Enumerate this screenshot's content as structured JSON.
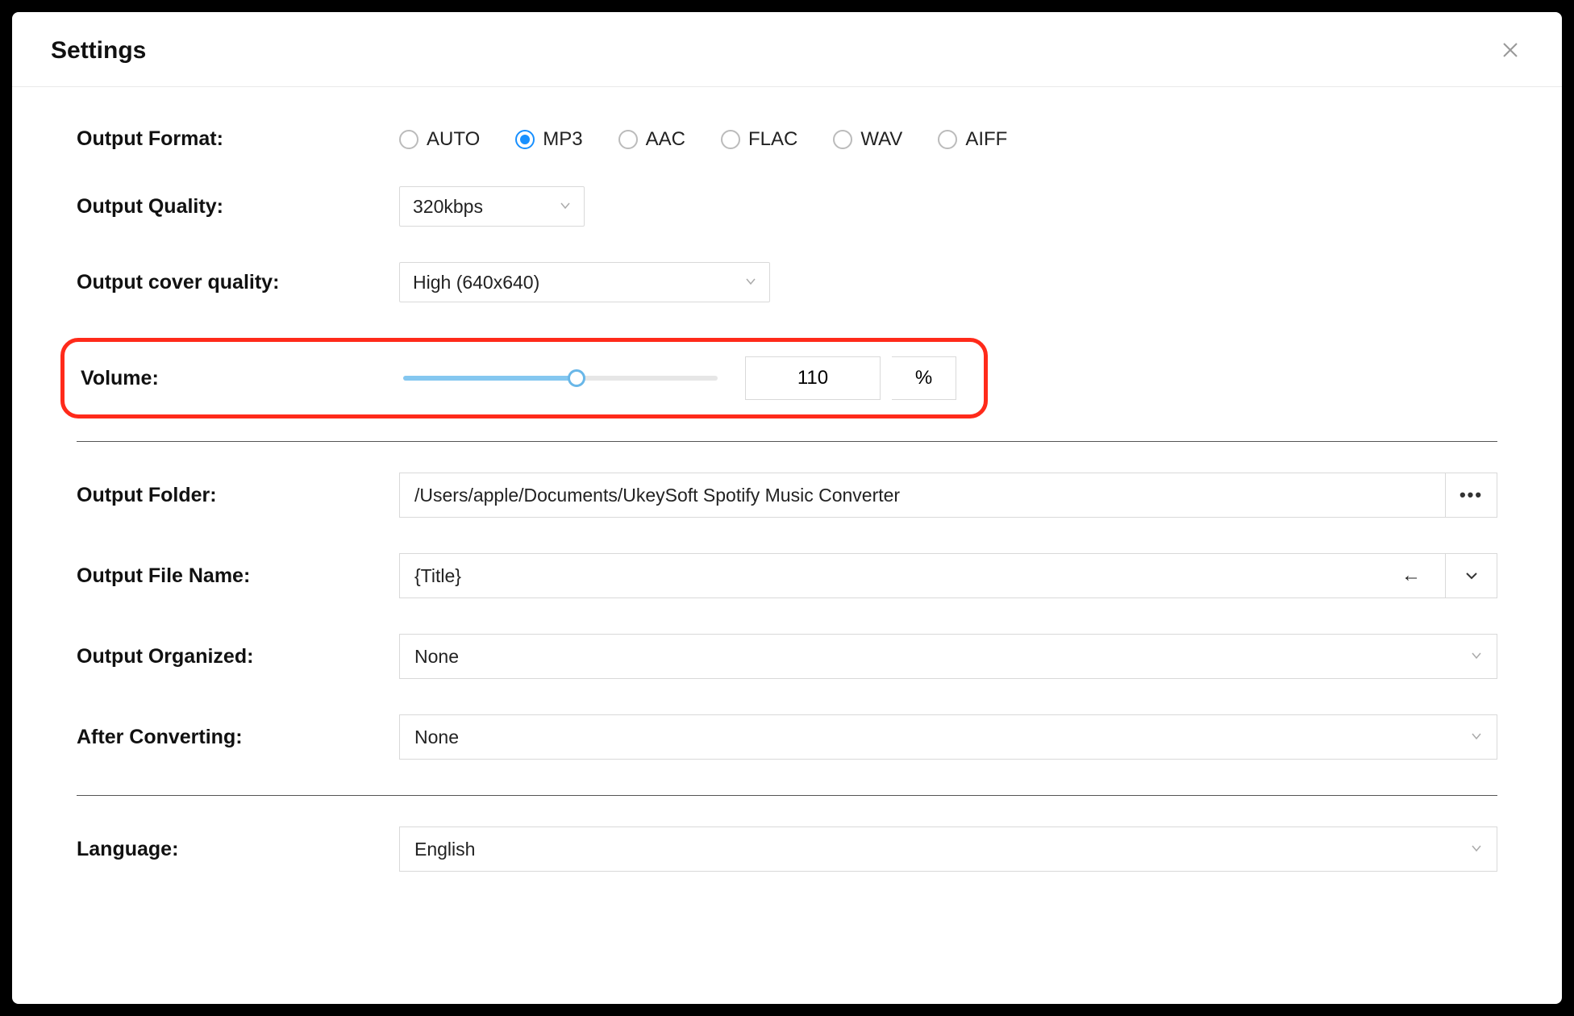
{
  "header": {
    "title": "Settings"
  },
  "labels": {
    "output_format": "Output Format:",
    "output_quality": "Output Quality:",
    "cover_quality": "Output cover quality:",
    "volume": "Volume:",
    "output_folder": "Output Folder:",
    "output_file_name": "Output File Name:",
    "output_organized": "Output Organized:",
    "after_converting": "After Converting:",
    "language": "Language:"
  },
  "format": {
    "options": [
      "AUTO",
      "MP3",
      "AAC",
      "FLAC",
      "WAV",
      "AIFF"
    ],
    "selected": "MP3"
  },
  "quality": {
    "value": "320kbps"
  },
  "cover_quality": {
    "value": "High (640x640)"
  },
  "volume": {
    "value": "110",
    "unit": "%",
    "percent": 55
  },
  "folder": {
    "value": "/Users/apple/Documents/UkeySoft Spotify Music Converter"
  },
  "filename": {
    "value": "{Title}"
  },
  "organized": {
    "value": "None"
  },
  "after_converting": {
    "value": "None"
  },
  "language": {
    "value": "English"
  }
}
